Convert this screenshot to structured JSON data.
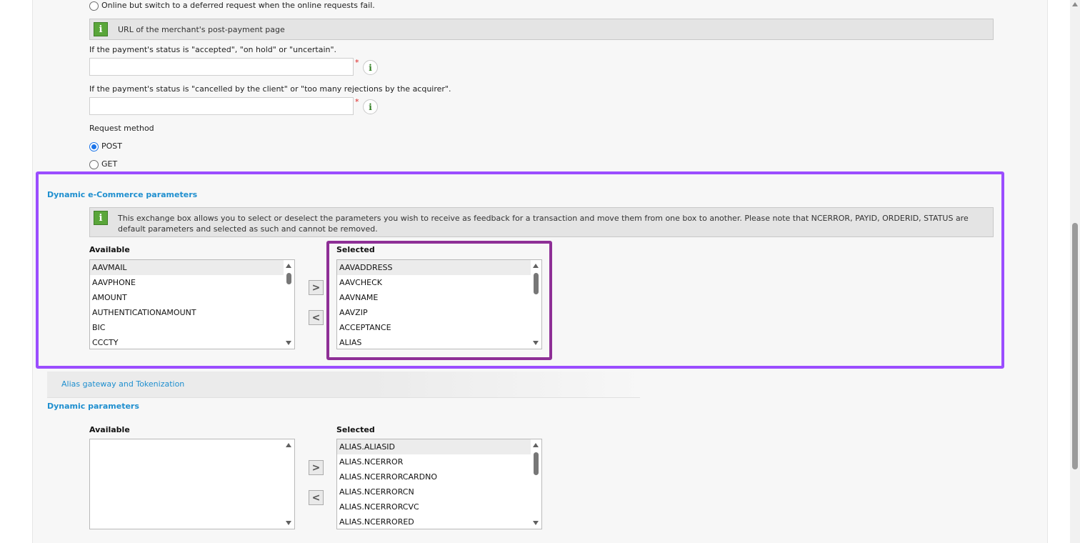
{
  "online_request": {
    "option_deferred_label": "Online but switch to a deferred request when the online requests fail."
  },
  "post_payment": {
    "info_text": "URL of the merchant's post-payment page",
    "accepted_label": "If the payment's status is \"accepted\", \"on hold\" or \"uncertain\".",
    "accepted_value": "",
    "cancelled_label": "If the payment's status is \"cancelled by the client\" or \"too many rejections by the acquirer\".",
    "cancelled_value": "",
    "required_mark": "*",
    "info_glyph": "i"
  },
  "request_method": {
    "label": "Request method",
    "options": [
      "POST",
      "GET"
    ],
    "selected": "POST"
  },
  "dynamic_ecommerce": {
    "title": "Dynamic e-Commerce parameters",
    "info_glyph": "i",
    "info_text_line1": "This exchange box allows you to select or deselect the parameters you wish to receive as feedback for a transaction and move them from one box to another. Please note that NCERROR, PAYID, ORDERID, STATUS are",
    "info_text_line2": "default parameters and selected as such and cannot be removed.",
    "available_label": "Available",
    "selected_label": "Selected",
    "available_items": [
      "AAVMAIL",
      "AAVPHONE",
      "AMOUNT",
      "AUTHENTICATIONAMOUNT",
      "BIC",
      "CCCTY"
    ],
    "selected_items": [
      "AAVADDRESS",
      "AAVCHECK",
      "AAVNAME",
      "AAVZIP",
      "ACCEPTANCE",
      "ALIAS"
    ],
    "add_glyph": ">",
    "remove_glyph": "<"
  },
  "alias_tab": {
    "label": "Alias gateway and Tokenization"
  },
  "dynamic_params": {
    "title": "Dynamic parameters",
    "available_label": "Available",
    "selected_label": "Selected",
    "available_items": [],
    "selected_items": [
      "ALIAS.ALIASID",
      "ALIAS.NCERROR",
      "ALIAS.NCERRORCARDNO",
      "ALIAS.NCERRORCN",
      "ALIAS.NCERRORCVC",
      "ALIAS.NCERRORED"
    ],
    "add_glyph": ">",
    "remove_glyph": "<"
  },
  "highlight_colors": {
    "outer": "#9b4dff",
    "inner": "#8e2f96"
  },
  "icons": {
    "info": "info-icon",
    "move_right": "arrow-right-icon",
    "move_left": "arrow-left-icon"
  }
}
